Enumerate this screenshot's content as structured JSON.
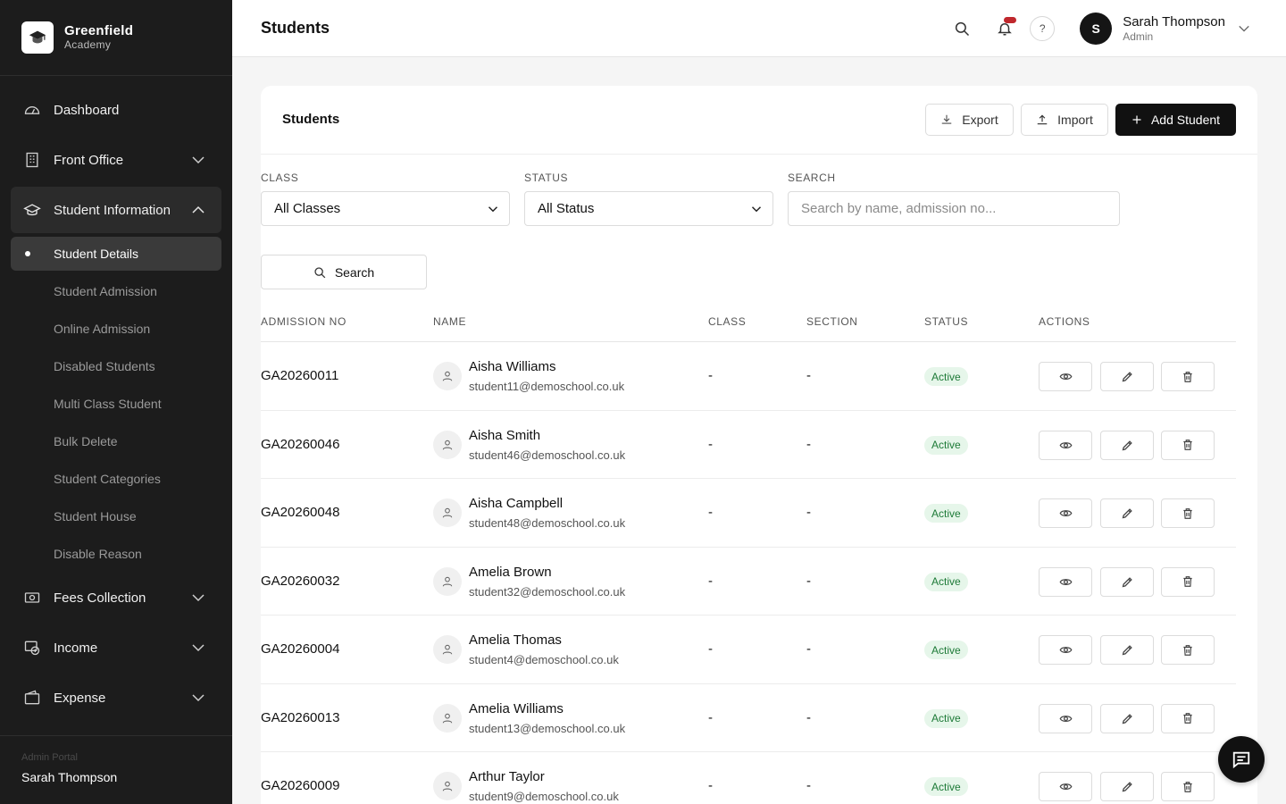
{
  "brand": {
    "name": "Greenfield",
    "sub": "Academy"
  },
  "sidebar": {
    "items": [
      {
        "label": "Dashboard",
        "icon": "dashboard-icon"
      },
      {
        "label": "Front Office",
        "icon": "building-icon"
      },
      {
        "label": "Student Information",
        "icon": "graduation-icon"
      },
      {
        "label": "Fees Collection",
        "icon": "money-icon"
      },
      {
        "label": "Income",
        "icon": "income-icon"
      },
      {
        "label": "Expense",
        "icon": "wallet-icon"
      }
    ],
    "sub_items": [
      "Student Details",
      "Student Admission",
      "Online Admission",
      "Disabled Students",
      "Multi Class Student",
      "Bulk Delete",
      "Student Categories",
      "Student House",
      "Disable Reason"
    ],
    "footer": {
      "portal": "Admin Portal",
      "name": "Sarah Thompson"
    }
  },
  "header": {
    "title": "Students",
    "user": {
      "initial": "S",
      "name": "Sarah Thompson",
      "role": "Admin"
    },
    "help": "?"
  },
  "card": {
    "title": "Students",
    "export_label": "Export",
    "import_label": "Import",
    "add_label": "Add Student"
  },
  "filters": {
    "class_label": "CLASS",
    "class_value": "All Classes",
    "status_label": "STATUS",
    "status_value": "All Status",
    "search_label": "SEARCH",
    "search_placeholder": "Search by name, admission no...",
    "search_button": "Search"
  },
  "table": {
    "headers": [
      "ADMISSION NO",
      "NAME",
      "CLASS",
      "SECTION",
      "STATUS",
      "ACTIONS"
    ],
    "rows": [
      {
        "adm": "GA20260011",
        "name": "Aisha Williams",
        "email": "student11@demoschool.co.uk",
        "class": "-",
        "section": "-",
        "status": "Active"
      },
      {
        "adm": "GA20260046",
        "name": "Aisha Smith",
        "email": "student46@demoschool.co.uk",
        "class": "-",
        "section": "-",
        "status": "Active"
      },
      {
        "adm": "GA20260048",
        "name": "Aisha Campbell",
        "email": "student48@demoschool.co.uk",
        "class": "-",
        "section": "-",
        "status": "Active"
      },
      {
        "adm": "GA20260032",
        "name": "Amelia Brown",
        "email": "student32@demoschool.co.uk",
        "class": "-",
        "section": "-",
        "status": "Active"
      },
      {
        "adm": "GA20260004",
        "name": "Amelia Thomas",
        "email": "student4@demoschool.co.uk",
        "class": "-",
        "section": "-",
        "status": "Active"
      },
      {
        "adm": "GA20260013",
        "name": "Amelia Williams",
        "email": "student13@demoschool.co.uk",
        "class": "-",
        "section": "-",
        "status": "Active"
      },
      {
        "adm": "GA20260009",
        "name": "Arthur Taylor",
        "email": "student9@demoschool.co.uk",
        "class": "-",
        "section": "-",
        "status": "Active"
      }
    ]
  },
  "colors": {
    "sidebar_bg": "#1c1c1c",
    "accent": "#111111",
    "status_bg": "#e6f6ea",
    "status_text": "#1d7a37",
    "notification": "#c0282d"
  }
}
